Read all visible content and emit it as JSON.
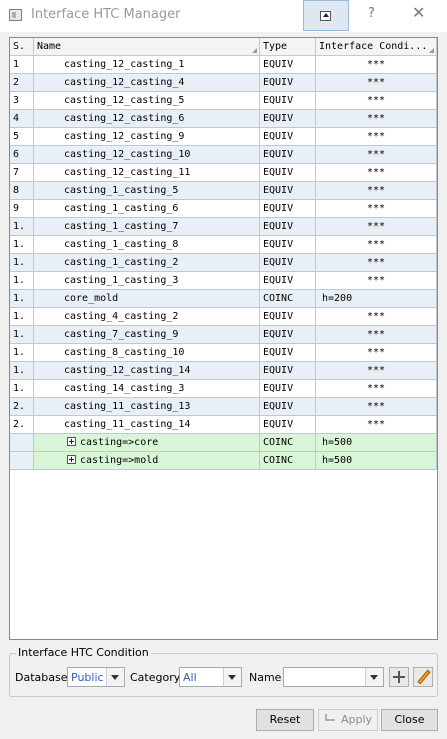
{
  "window": {
    "title": "Interface HTC Manager",
    "help_glyph": "?",
    "close_glyph": "✕"
  },
  "grid": {
    "columns": [
      "S.",
      "Name",
      "Type",
      "Interface Condi..."
    ],
    "rows": [
      {
        "s": "1",
        "name": "casting_12_casting_1",
        "type": "EQUIV",
        "cond": "***"
      },
      {
        "s": "2",
        "name": "casting_12_casting_4",
        "type": "EQUIV",
        "cond": "***"
      },
      {
        "s": "3",
        "name": "casting_12_casting_5",
        "type": "EQUIV",
        "cond": "***"
      },
      {
        "s": "4",
        "name": "casting_12_casting_6",
        "type": "EQUIV",
        "cond": "***"
      },
      {
        "s": "5",
        "name": "casting_12_casting_9",
        "type": "EQUIV",
        "cond": "***"
      },
      {
        "s": "6",
        "name": "casting_12_casting_10",
        "type": "EQUIV",
        "cond": "***"
      },
      {
        "s": "7",
        "name": "casting_12_casting_11",
        "type": "EQUIV",
        "cond": "***"
      },
      {
        "s": "8",
        "name": "casting_1_casting_5",
        "type": "EQUIV",
        "cond": "***"
      },
      {
        "s": "9",
        "name": "casting_1_casting_6",
        "type": "EQUIV",
        "cond": "***"
      },
      {
        "s": "1.",
        "name": "casting_1_casting_7",
        "type": "EQUIV",
        "cond": "***"
      },
      {
        "s": "1.",
        "name": "casting_1_casting_8",
        "type": "EQUIV",
        "cond": "***"
      },
      {
        "s": "1.",
        "name": "casting_1_casting_2",
        "type": "EQUIV",
        "cond": "***"
      },
      {
        "s": "1.",
        "name": "casting_1_casting_3",
        "type": "EQUIV",
        "cond": "***"
      },
      {
        "s": "1.",
        "name": "core_mold",
        "type": "COINC",
        "cond": "h=200"
      },
      {
        "s": "1.",
        "name": "casting_4_casting_2",
        "type": "EQUIV",
        "cond": "***"
      },
      {
        "s": "1.",
        "name": "casting_7_casting_9",
        "type": "EQUIV",
        "cond": "***"
      },
      {
        "s": "1.",
        "name": "casting_8_casting_10",
        "type": "EQUIV",
        "cond": "***"
      },
      {
        "s": "1.",
        "name": "casting_12_casting_14",
        "type": "EQUIV",
        "cond": "***"
      },
      {
        "s": "1.",
        "name": "casting_14_casting_3",
        "type": "EQUIV",
        "cond": "***"
      },
      {
        "s": "2.",
        "name": "casting_11_casting_13",
        "type": "EQUIV",
        "cond": "***"
      },
      {
        "s": "2.",
        "name": "casting_11_casting_14",
        "type": "EQUIV",
        "cond": "***"
      }
    ],
    "group_rows": [
      {
        "s": "",
        "name": "casting=>core",
        "type": "COINC",
        "cond": "h=500"
      },
      {
        "s": "",
        "name": "casting=>mold",
        "type": "COINC",
        "cond": "h=500"
      }
    ]
  },
  "condition_panel": {
    "legend": "Interface HTC Condition",
    "database_label": "Database",
    "database_value": "Public",
    "category_label": "Category",
    "category_value": "All",
    "name_label": "Name",
    "name_value": ""
  },
  "buttons": {
    "reset": "Reset",
    "apply": "Apply",
    "close": "Close"
  }
}
